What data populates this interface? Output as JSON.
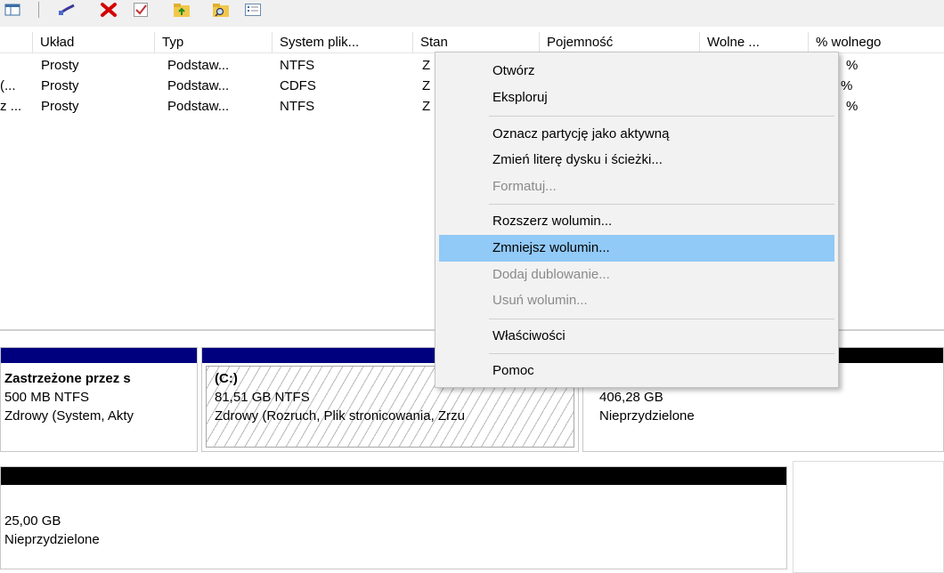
{
  "toolbar": {
    "icons": [
      "layout-icon",
      "connect-icon",
      "delete-icon",
      "check-icon",
      "folder-up-icon",
      "search-folder-icon",
      "properties-icon"
    ]
  },
  "list": {
    "columns": [
      "Układ",
      "Typ",
      "System plik...",
      "Stan",
      "Pojemność",
      "Wolne ...",
      "% wolnego"
    ],
    "rows": [
      {
        "name": "",
        "layout": "Prosty",
        "type": "Podstaw...",
        "fs": "NTFS",
        "status": "Z",
        "pct": "%"
      },
      {
        "name": "(...",
        "layout": "Prosty",
        "type": "Podstaw...",
        "fs": "CDFS",
        "status": "Z",
        "pct": "%"
      },
      {
        "name": "z ...",
        "layout": "Prosty",
        "type": "Podstaw...",
        "fs": "NTFS",
        "status": "Z",
        "pct": "%"
      }
    ]
  },
  "disks": {
    "reserved": {
      "title": "Zastrzeżone przez s",
      "size": "500 MB NTFS",
      "status": "Zdrowy (System, Akty"
    },
    "c_drive": {
      "title": "(C:)",
      "size": "81,51 GB NTFS",
      "status": "Zdrowy (Rozruch, Plik stronicowania, Zrzu"
    },
    "unalloc1": {
      "size": "406,28 GB",
      "status": "Nieprzydzielone"
    },
    "unalloc2": {
      "size": "25,00 GB",
      "status": "Nieprzydzielone"
    }
  },
  "context_menu": {
    "open": "Otwórz",
    "explore": "Eksploruj",
    "mark_active": "Oznacz partycję jako aktywną",
    "change_letter": "Zmień literę dysku i ścieżki...",
    "format": "Formatuj...",
    "extend": "Rozszerz wolumin...",
    "shrink": "Zmniejsz wolumin...",
    "add_mirror": "Dodaj dublowanie...",
    "delete": "Usuń wolumin...",
    "properties": "Właściwości",
    "help": "Pomoc"
  },
  "colors": {
    "primary_partition": "#00007f",
    "unallocated": "#000000",
    "selection": "#91c9f7",
    "disabled_text": "#8a8a8a"
  }
}
